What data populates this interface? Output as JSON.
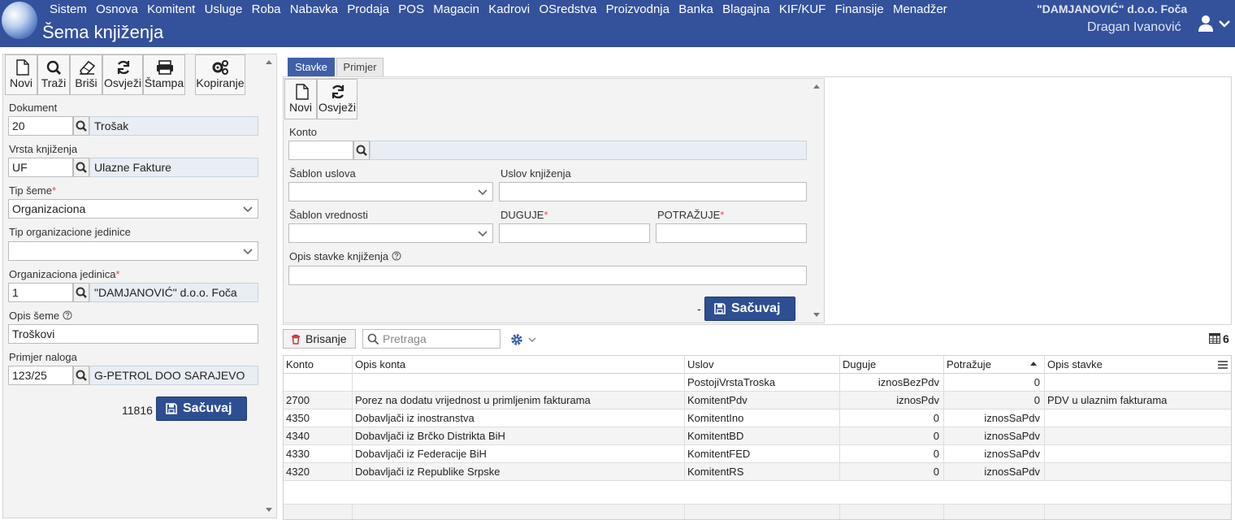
{
  "app": {
    "menu": [
      "Sistem",
      "Osnova",
      "Komitent",
      "Usluge",
      "Roba",
      "Nabavka",
      "Prodaja",
      "POS",
      "Magacin",
      "Kadrovi",
      "OSredstva",
      "Proizvodnja",
      "Banka",
      "Blagajna",
      "KIF/KUF",
      "Finansije",
      "Menadžer"
    ],
    "company": "\"DAMJANOVIĆ\" d.o.o. Foča",
    "page_title": "Šema knjiženja",
    "user": "Dragan Ivanović",
    "accent": "#34519c"
  },
  "left": {
    "toolbar": {
      "new": "Novi",
      "search": "Traži",
      "delete": "Briši",
      "refresh": "Osvježi",
      "print": "Štampa",
      "copy": "Kopiranje"
    },
    "dokument": {
      "label": "Dokument",
      "code": "20",
      "name": "Trošak"
    },
    "vrsta": {
      "label": "Vrsta knjiženja",
      "code": "UF",
      "name": "Ulazne Fakture"
    },
    "tip_seme": {
      "label": "Tip šeme",
      "value": "Organizaciona"
    },
    "tip_org": {
      "label": "Tip organizacione jedinice",
      "value": ""
    },
    "org_jed": {
      "label": "Organizaciona jedinica",
      "code": "1",
      "name": "\"DAMJANOVIĆ\" d.o.o. Foča"
    },
    "opis": {
      "label": "Opis šeme",
      "value": "Troškovi"
    },
    "primjer": {
      "label": "Primjer naloga",
      "code": "123/25",
      "name": "G-PETROL DOO SARAJEVO"
    },
    "record_id": "11816",
    "save": "Sačuvaj"
  },
  "tabs": {
    "stavke": "Stavke",
    "primjer": "Primjer"
  },
  "form": {
    "toolbar": {
      "new": "Novi",
      "refresh": "Osvježi"
    },
    "konto": {
      "label": "Konto",
      "value": "",
      "name": ""
    },
    "sablon_uslova": {
      "label": "Šablon uslova",
      "value": ""
    },
    "uslov": {
      "label": "Uslov knjiženja",
      "value": ""
    },
    "sablon_vrednosti": {
      "label": "Šablon vrednosti",
      "value": ""
    },
    "duguje": {
      "label": "DUGUJE",
      "value": ""
    },
    "potrazuje": {
      "label": "POTRAŽUJE",
      "value": ""
    },
    "opis_stavke": {
      "label": "Opis stavke knjiženja",
      "value": ""
    },
    "dash": "-",
    "save": "Sačuvaj"
  },
  "grid": {
    "delete": "Brisanje",
    "search_placeholder": "Pretraga",
    "count": "6",
    "columns": [
      "Konto",
      "Opis konta",
      "Uslov",
      "Duguje",
      "Potražuje",
      "Opis stavke"
    ],
    "rows": [
      [
        "",
        "",
        "PostojiVrstaTroska",
        "iznosBezPdv",
        "0",
        ""
      ],
      [
        "2700",
        "Porez na dodatu vrijednost u primljenim fakturama",
        "KomitentPdv",
        "iznosPdv",
        "0",
        "PDV u ulaznim fakturama"
      ],
      [
        "4350",
        "Dobavljači iz inostranstva",
        "KomitentIno",
        "0",
        "iznosSaPdv",
        ""
      ],
      [
        "4340",
        "Dobavljači iz Brčko Distrikta BiH",
        "KomitentBD",
        "0",
        "iznosSaPdv",
        ""
      ],
      [
        "4330",
        "Dobavljači iz Federacije BiH",
        "KomitentFED",
        "0",
        "iznosSaPdv",
        ""
      ],
      [
        "4320",
        "Dobavljači iz Republike Srpske",
        "KomitentRS",
        "0",
        "iznosSaPdv",
        ""
      ]
    ]
  }
}
